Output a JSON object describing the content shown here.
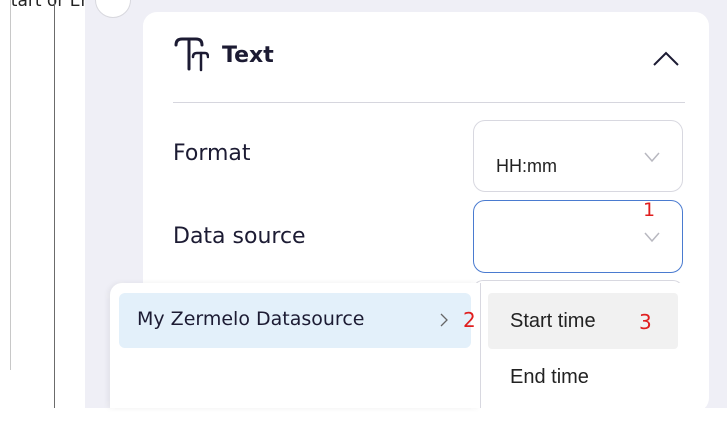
{
  "caption": "Start or End time.",
  "panel": {
    "title": "Text",
    "fields": {
      "format": {
        "label": "Format",
        "value": "HH:mm"
      },
      "data_source": {
        "label": "Data source",
        "value": ""
      }
    }
  },
  "dropdown": {
    "datasources": [
      {
        "label": "My Zermelo Datasource"
      }
    ],
    "options": [
      {
        "label": "Start time"
      },
      {
        "label": "End time"
      }
    ]
  },
  "annotations": {
    "select": "1",
    "datasource": "2",
    "start": "3"
  },
  "colors": {
    "annotation": "#e01e1e",
    "focus_border": "#4a7bd0",
    "selected_bg": "#e3f0fa"
  }
}
